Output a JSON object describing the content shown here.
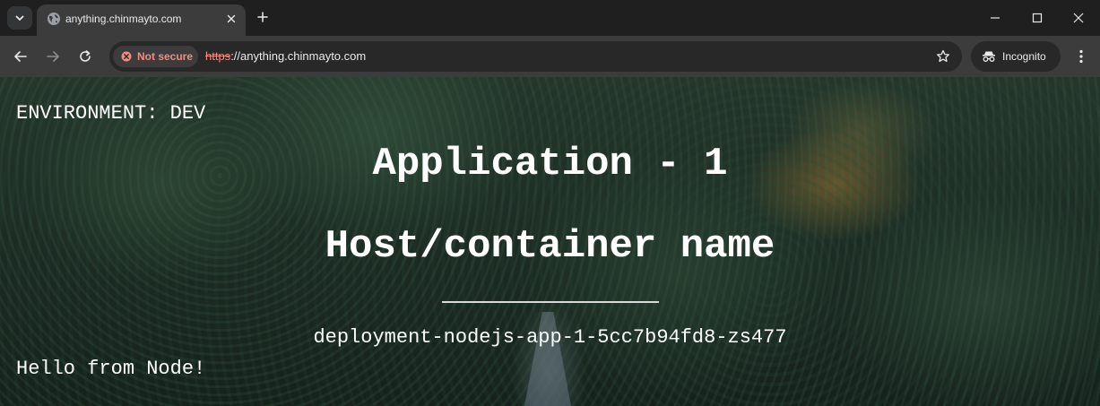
{
  "browser": {
    "tab": {
      "title": "anything.chinmayto.com"
    },
    "address_bar": {
      "security_label": "Not secure",
      "url_scheme": "https",
      "url_rest": "://anything.chinmayto.com"
    },
    "profile_label": "Incognito"
  },
  "page": {
    "environment": "ENVIRONMENT: DEV",
    "app_title": "Application - 1",
    "host_heading": "Host/container name",
    "hostname": "deployment-nodejs-app-1-5cc7b94fd8-zs477",
    "greeting": "Hello from Node!"
  },
  "colors": {
    "tabstrip_bg": "#1f1f1f",
    "toolbar_bg": "#3c3c3c",
    "not_secure": "#f28b82",
    "page_text": "#ffffff"
  }
}
